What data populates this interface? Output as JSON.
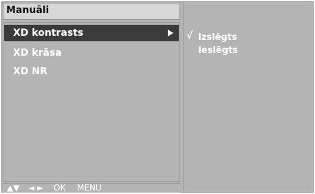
{
  "menu": {
    "title": "Manuāli",
    "items": [
      {
        "label": "XD kontrasts"
      },
      {
        "label": "XD krāsa"
      },
      {
        "label": "XD NR"
      }
    ]
  },
  "submenu": {
    "check_mark": "√",
    "options": [
      {
        "label": "Izslēgts"
      },
      {
        "label": "Ieslēgts"
      }
    ]
  },
  "footer": {
    "updown": "▲▼",
    "leftright": "◄ ►",
    "ok": "OK",
    "menu": "MENU"
  }
}
